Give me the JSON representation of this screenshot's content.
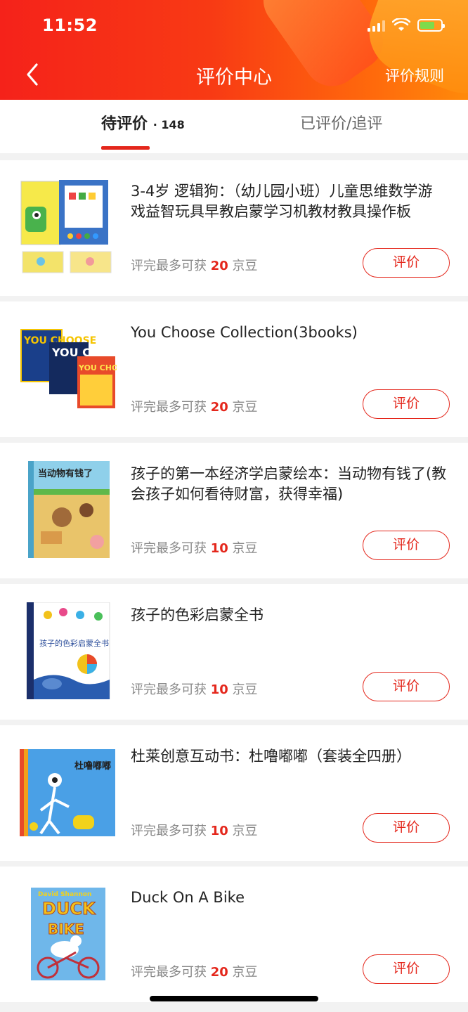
{
  "status": {
    "time": "11:52"
  },
  "header": {
    "title": "评价中心",
    "rules": "评价规则"
  },
  "tabs": [
    {
      "label": "待评价",
      "count": "· 148"
    },
    {
      "label": "已评价/追评"
    }
  ],
  "reward_prefix": "评完最多可获 ",
  "reward_suffix": " 京豆",
  "review_button": "评价",
  "items": [
    {
      "name": "3-4岁 逻辑狗：（幼儿园小班）儿童思维数学游戏益智玩具早教启蒙学习机教材教具操作板",
      "beans": "20"
    },
    {
      "name": "You Choose Collection(3books)",
      "beans": "20"
    },
    {
      "name": "孩子的第一本经济学启蒙绘本：当动物有钱了(教会孩子如何看待财富，获得幸福)",
      "beans": "10"
    },
    {
      "name": "孩子的色彩启蒙全书",
      "beans": "10"
    },
    {
      "name": "杜莱创意互动书：杜噜嘟嘟（套装全四册）",
      "beans": "10"
    },
    {
      "name": "Duck On A Bike",
      "beans": "20"
    }
  ],
  "covers": {
    "c1": {
      "t1": "YOU CHOOSE",
      "t2": "YOU CHOO",
      "t3": "YOU CHOOSE"
    },
    "c2": {
      "title": "当动物有钱了"
    },
    "c3": {
      "title": "孩子的色彩启蒙全书"
    },
    "c4": {
      "title": "杜噜嘟嘟"
    },
    "c5": {
      "author": "David Shannon",
      "title1": "DUCK",
      "title2": "BIKE"
    }
  },
  "colors": {
    "accent": "#e4271c",
    "header_start": "#f5221a",
    "header_end": "#ff8a0a"
  }
}
